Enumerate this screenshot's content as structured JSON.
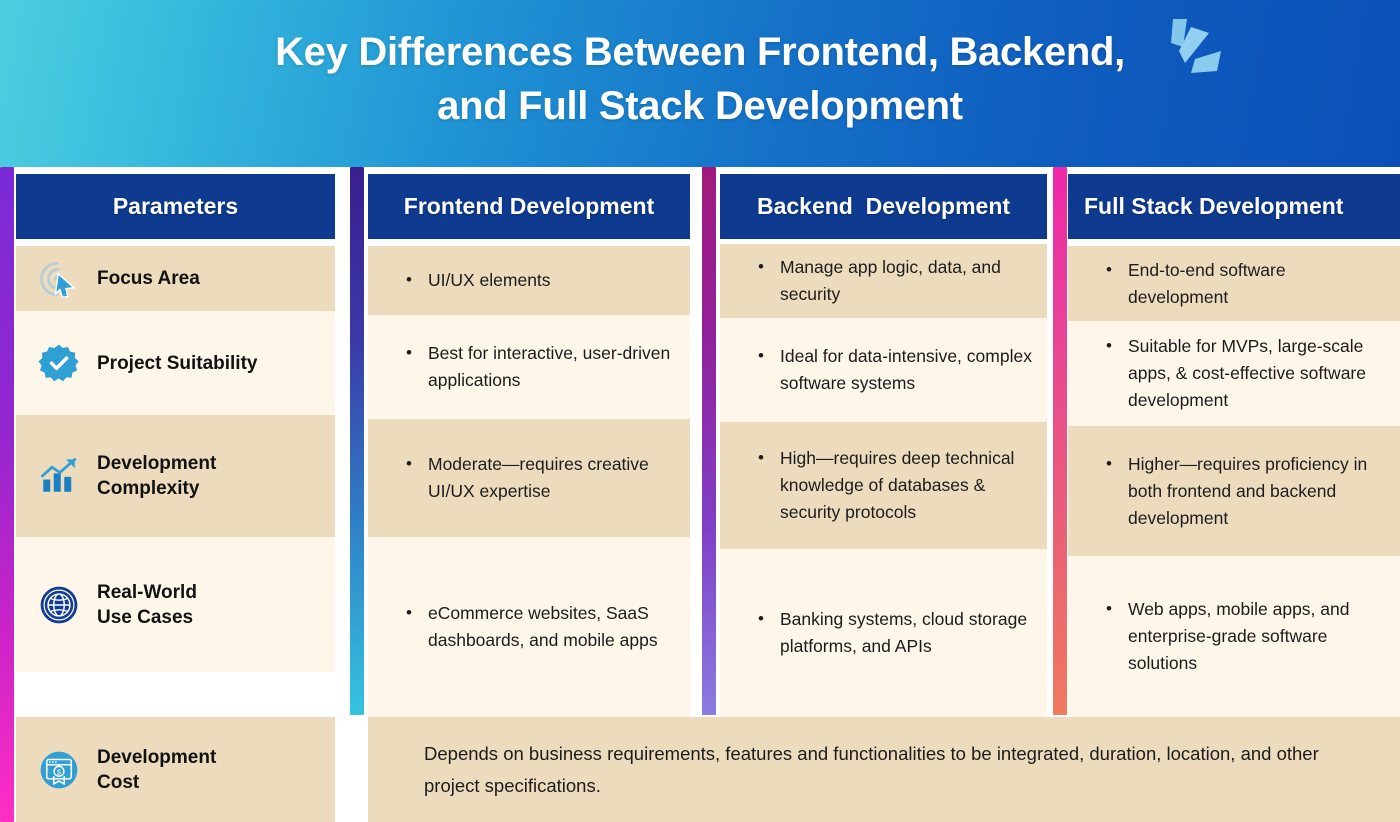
{
  "banner": {
    "title_line1": "Key Differences Between Frontend, Backend,",
    "title_line2": "and Full Stack Development",
    "logo_name": "brand-logo-icon"
  },
  "colors": {
    "header_bar": "#0e3a8f",
    "row_tan": "#ecdcbd",
    "row_cream": "#fdf6e9",
    "banner_gradient_start": "#4ccfdf",
    "banner_gradient_end": "#0b4fb6",
    "strip_parameters": [
      "#7a2bd6",
      "#ff2ec4"
    ],
    "strip_frontend": [
      "#3a1e8f",
      "#35c3e0"
    ],
    "strip_backend": [
      "#a01a7d",
      "#8b7ce0"
    ],
    "strip_fullstack": [
      "#ef28a8",
      "#ef7a5e"
    ],
    "icon_blue": "#2f9fd4",
    "icon_navy": "#123d94"
  },
  "columns": [
    {
      "id": "parameters",
      "header": "Parameters"
    },
    {
      "id": "frontend",
      "header": "Frontend Development"
    },
    {
      "id": "backend",
      "header": "Backend  Development"
    },
    {
      "id": "fullstack",
      "header": "Full Stack Development"
    }
  ],
  "rows": [
    {
      "parameter": "Focus Area",
      "icon": "target-cursor-icon",
      "frontend": [
        "UI/UX elements"
      ],
      "backend": [
        "Manage app logic, data, and security"
      ],
      "fullstack": [
        "End-to-end software development"
      ]
    },
    {
      "parameter": "Project Suitability",
      "icon": "verified-check-badge-icon",
      "frontend": [
        "Best for interactive, user-driven applications"
      ],
      "backend": [
        "Ideal for data-intensive, complex software systems"
      ],
      "fullstack": [
        "Suitable for MVPs, large-scale apps, & cost-effective software development"
      ]
    },
    {
      "parameter": "Development\nComplexity",
      "icon": "growth-chart-icon",
      "frontend": [
        "Moderate—requires creative UI/UX expertise"
      ],
      "backend": [
        "High—requires deep technical knowledge of databases & security protocols"
      ],
      "fullstack": [
        "Higher—requires proficiency in both frontend and backend development"
      ]
    },
    {
      "parameter": "Real-World\nUse Cases",
      "icon": "globe-icon",
      "frontend": [
        "eCommerce websites, SaaS dashboards, and mobile apps"
      ],
      "backend": [
        "Banking systems, cloud storage platforms, and APIs"
      ],
      "fullstack": [
        "Web apps, mobile apps, and enterprise-grade software solutions"
      ]
    },
    {
      "parameter": "Development\nCost",
      "icon": "cost-window-icon",
      "merged_note": "Depends on business requirements, features and functionalities to be integrated, duration, location, and other project specifications."
    }
  ]
}
